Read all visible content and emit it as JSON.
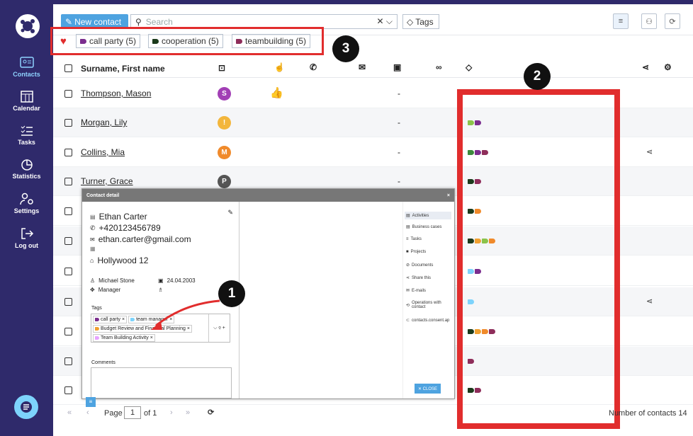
{
  "sidebar": {
    "items": [
      {
        "label": "Contacts"
      },
      {
        "label": "Calendar"
      },
      {
        "label": "Tasks"
      },
      {
        "label": "Statistics"
      },
      {
        "label": "Settings"
      },
      {
        "label": "Log out"
      }
    ]
  },
  "toolbar": {
    "new_contact": "New contact",
    "search_placeholder": "Search",
    "tags_label": "Tags"
  },
  "filters": {
    "tags": [
      {
        "label": "call party (5)",
        "color": "#7b2d8e"
      },
      {
        "label": "cooperation (5)",
        "color": "#1b3a1b"
      },
      {
        "label": "teambuilding (5)",
        "color": "#8e2d5a"
      }
    ]
  },
  "annotations": {
    "n1": "1",
    "n2": "2",
    "n3": "3"
  },
  "table": {
    "header": {
      "name": "Surname, First name"
    },
    "rows": [
      {
        "name": "Thompson, Mason",
        "avatar": "S",
        "avatar_color": "#a23fb5",
        "dash": "-",
        "tags": []
      },
      {
        "name": "Morgan, Lily",
        "avatar": "!",
        "avatar_color": "#f3b63c",
        "dash": "-",
        "tags": [
          "#8bc34a",
          "#7b2d8e"
        ]
      },
      {
        "name": "Collins, Mia",
        "avatar": "M",
        "avatar_color": "#f08a2b",
        "dash": "-",
        "tags": [
          "#3c8a3c",
          "#7b2d8e",
          "#8e2d5a"
        ]
      },
      {
        "name": "Turner, Grace",
        "avatar": "P",
        "avatar_color": "#555555",
        "dash": "-",
        "tags": [
          "#1b3a1b",
          "#8e2d5a"
        ]
      },
      {
        "name": "",
        "avatar": "",
        "dash": "",
        "tags": [
          "#1b3a1b",
          "#f08a2b"
        ]
      },
      {
        "name": "",
        "avatar": "",
        "dash": "",
        "tags": [
          "#1b3a1b",
          "#f0a030",
          "#8bc34a",
          "#f08a2b"
        ]
      },
      {
        "name": "",
        "avatar": "",
        "dash": "",
        "tags": [
          "#7dd3fc",
          "#7b2d8e"
        ]
      },
      {
        "name": "",
        "avatar": "",
        "dash": "",
        "tags": [
          "#7dd3fc"
        ]
      },
      {
        "name": "",
        "avatar": "",
        "dash": "",
        "tags": [
          "#1b3a1b",
          "#f0a030",
          "#f08a2b",
          "#8e2d5a"
        ]
      },
      {
        "name": "",
        "avatar": "",
        "dash": "",
        "tags": [
          "#8e2d5a"
        ]
      },
      {
        "name": "",
        "avatar": "",
        "dash": "",
        "tags": [
          "#1b3a1b",
          "#8e2d5a"
        ]
      }
    ]
  },
  "pager": {
    "page_label": "Page",
    "page": "1",
    "of": "of 1",
    "count": "Number of contacts 14"
  },
  "modal": {
    "title": "Contact detail",
    "name": "Ethan Carter",
    "phone": "+420123456789",
    "email": "ethan.carter@gmail.com",
    "address": "Hollywood 12",
    "owner": "Michael Stone",
    "date": "24.04.2003",
    "role": "Manager",
    "tags_label": "Tags",
    "tags": [
      "call party",
      "team manager",
      "Budget Review and Financial Planning",
      "Team Building Activity"
    ],
    "comments_label": "Comments",
    "close": "✕ CLOSE",
    "menu": [
      "Activities",
      "Business cases",
      "Tasks",
      "Projects",
      "Documents",
      "Share this",
      "E-mails",
      "Operations with contact",
      "contacts.consent.ap"
    ]
  }
}
